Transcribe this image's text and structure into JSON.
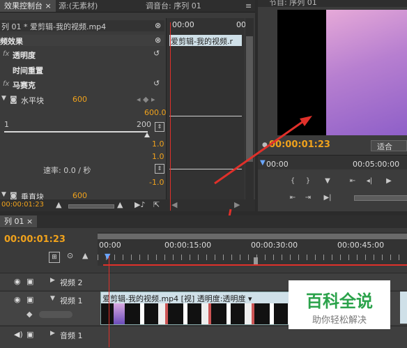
{
  "tabs_top": {
    "effect_controls": "效果控制台",
    "source": "源:(无素材)",
    "audio_mixer": "调音台: 序列 01",
    "program": "节目: 序列 01"
  },
  "effect_panel": {
    "sequence_clip": "列 01 * 爱剪辑-我的视频.mp4",
    "video_effects": "频效果",
    "mini_timecode": "00:00",
    "mini_clip": "爱剪辑-我的视频.r",
    "opacity": "透明度",
    "time_remap": "时间重置",
    "mosaic": "马赛克",
    "horizontal_blocks": "水平块",
    "horizontal_value": "600",
    "slider_min": "1",
    "slider_max": "200",
    "graph_value_top": "600.0",
    "val_1": "1.0",
    "val_2": "1.0",
    "speed_label": "速率: 0.0 / 秒",
    "val_neg": "-1.0",
    "vertical_blocks": "垂直块",
    "vertical_value": "600",
    "timecode_bottom": "00:00:01:23"
  },
  "program_monitor": {
    "timecode": "00:00:01:23",
    "fit_label": "适合",
    "ruler_start": "00:00",
    "ruler_mid": "00:05:00:00"
  },
  "timeline": {
    "tab_label": "列 01",
    "timecode": "00:00:01:23",
    "ruler_labels": [
      "00:00",
      "00:00:15:00",
      "00:00:30:00",
      "00:00:45:00"
    ],
    "tracks": [
      {
        "name": "视频 2"
      },
      {
        "name": "视频 1"
      },
      {
        "name": "音频 1"
      }
    ],
    "clip_title": "爱剪辑-我的视频.mp4 [视] 透明度:透明度 ▾"
  },
  "watermark": {
    "title": "百科全说",
    "subtitle": "助你轻松解决"
  },
  "colors": {
    "accent_orange": "#f0a21c",
    "annotation_red": "#e0302a",
    "panel_bg": "#3a3a3a",
    "watermark_green": "#2aa24a"
  }
}
